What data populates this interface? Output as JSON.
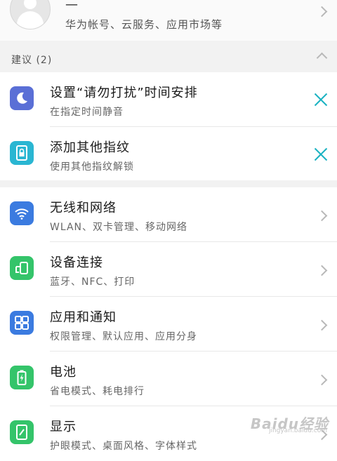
{
  "account": {
    "name": "—",
    "subtitle": "华为帐号、云服务、应用市场等"
  },
  "suggestions": {
    "header": "建议 (2)",
    "items": [
      {
        "title": "设置“请勿打扰”时间安排",
        "subtitle": "在指定时间静音",
        "icon": "moon-icon",
        "color": "#5a6fd6"
      },
      {
        "title": "添加其他指纹",
        "subtitle": "使用其他指纹解锁",
        "icon": "fingerprint-lock-icon",
        "color": "#2ab6d2"
      }
    ]
  },
  "settings": [
    {
      "title": "无线和网络",
      "subtitle": "WLAN、双卡管理、移动网络",
      "icon": "wifi-icon",
      "color": "#3b7be0"
    },
    {
      "title": "设备连接",
      "subtitle": "蓝牙、NFC、打印",
      "icon": "device-connect-icon",
      "color": "#34c46a"
    },
    {
      "title": "应用和通知",
      "subtitle": "权限管理、默认应用、应用分身",
      "icon": "apps-grid-icon",
      "color": "#3b7be0"
    },
    {
      "title": "电池",
      "subtitle": "省电模式、耗电排行",
      "icon": "battery-icon",
      "color": "#34c46a"
    },
    {
      "title": "显示",
      "subtitle": "护眼模式、桌面风格、字体样式",
      "icon": "display-icon",
      "color": "#34c46a"
    }
  ],
  "watermark": {
    "main": "Baidu经验",
    "sub": "jingyan.baidu.com"
  }
}
